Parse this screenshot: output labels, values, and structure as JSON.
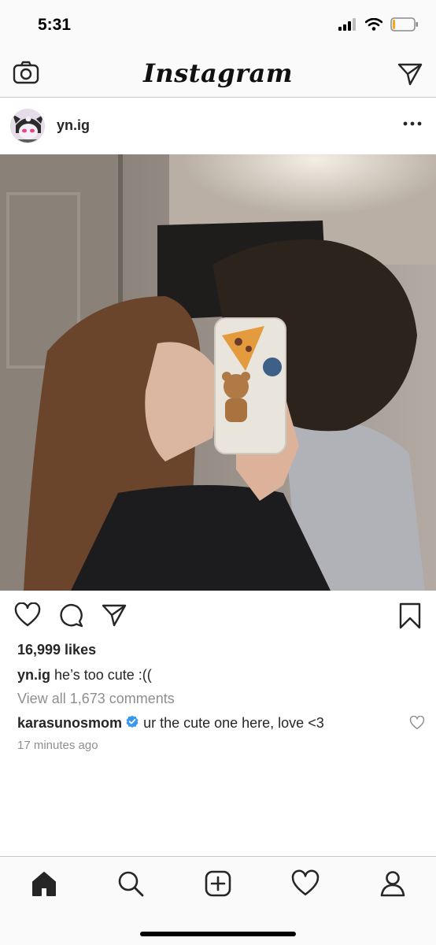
{
  "status_bar": {
    "time": "5:31",
    "battery_level": 0.12
  },
  "header": {
    "title": "Instagram"
  },
  "post": {
    "username": "yn.ig",
    "likes": "16,999 likes",
    "caption_user": "yn.ig",
    "caption_text": "he’s too cute :((",
    "view_all": "View all 1,673 comments",
    "comment_user": "karasunosmom",
    "comment_text": "ur the cute one here, love <3",
    "time_ago": "17 minutes ago"
  },
  "colors": {
    "verified": "#3897f0",
    "muted": "#8e8e8e",
    "text": "#262626",
    "bar_bg": "#fafafa"
  },
  "icons": {
    "nav": [
      "camera-icon",
      "send-icon"
    ],
    "actions": [
      "heart-icon",
      "comment-icon",
      "share-icon",
      "bookmark-icon"
    ],
    "tabs": [
      "home-icon",
      "search-icon",
      "add-post-icon",
      "activity-icon",
      "profile-icon"
    ]
  }
}
